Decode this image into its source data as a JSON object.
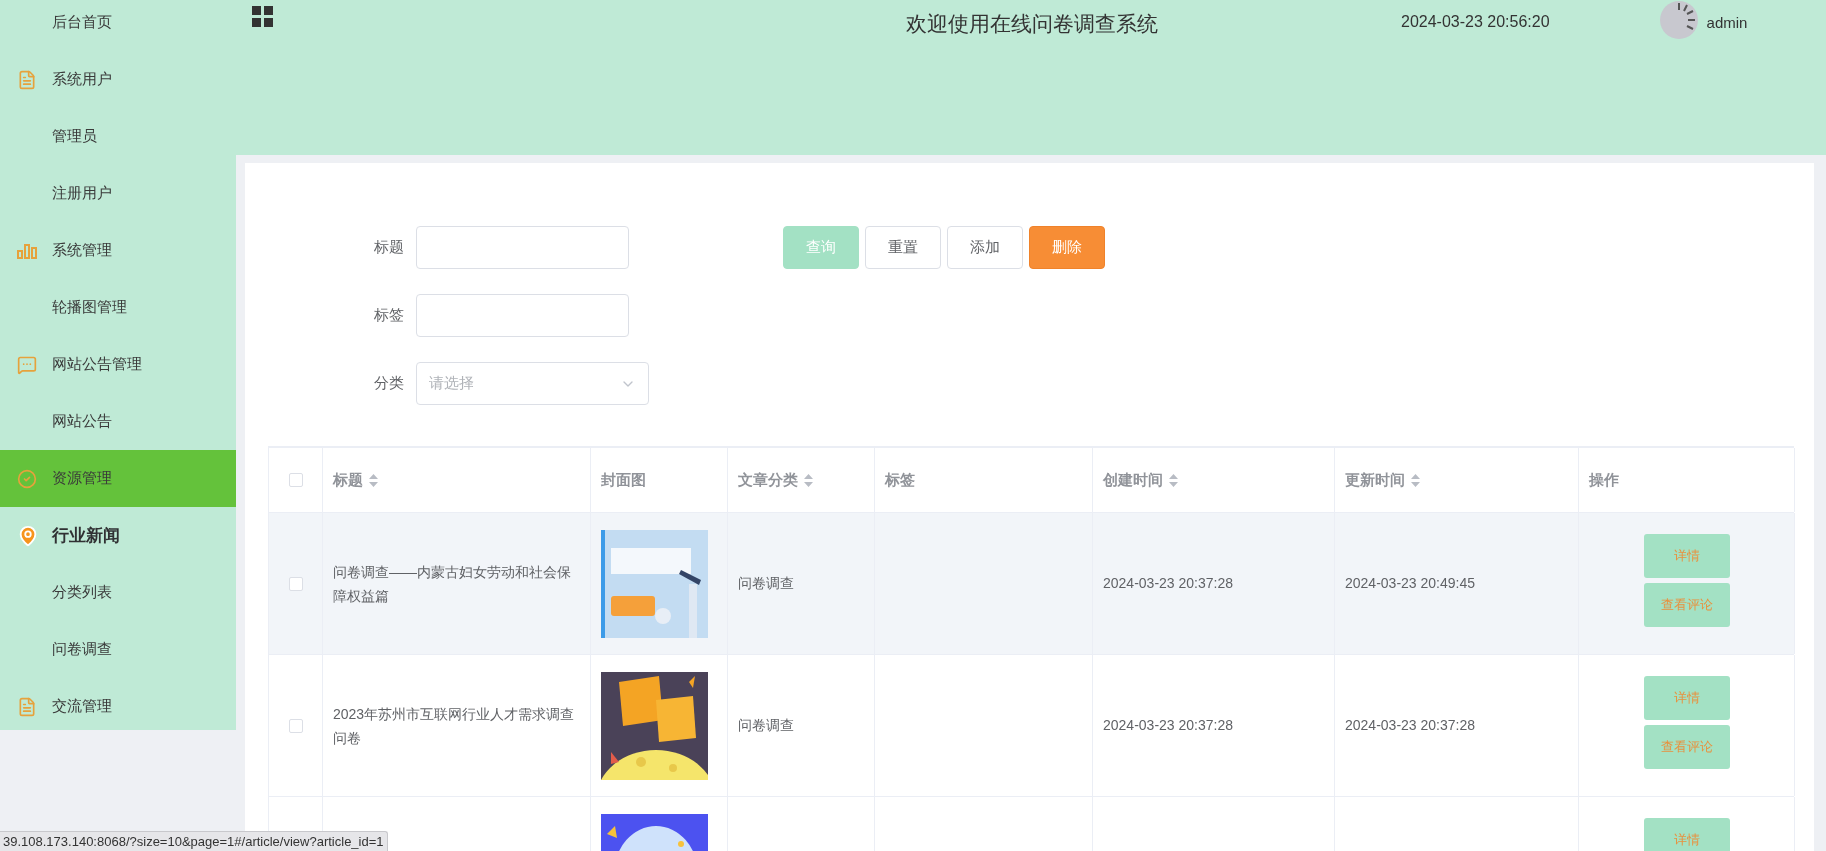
{
  "header": {
    "title": "欢迎使用在线问卷调查系统",
    "datetime": "2024-03-23 20:56:20",
    "user": "admin"
  },
  "sidebar": {
    "items": [
      {
        "label": "后台首页",
        "kind": "link",
        "selected": false,
        "active": false
      },
      {
        "label": "系统用户",
        "kind": "group",
        "selected": false,
        "active": false
      },
      {
        "label": "管理员",
        "kind": "link",
        "selected": false,
        "active": false
      },
      {
        "label": "注册用户",
        "kind": "link",
        "selected": false,
        "active": false
      },
      {
        "label": "系统管理",
        "kind": "group",
        "selected": false,
        "active": false
      },
      {
        "label": "轮播图管理",
        "kind": "link",
        "selected": false,
        "active": false
      },
      {
        "label": "网站公告管理",
        "kind": "group",
        "selected": false,
        "active": false
      },
      {
        "label": "网站公告",
        "kind": "link",
        "selected": false,
        "active": false
      },
      {
        "label": "资源管理",
        "kind": "group",
        "selected": true,
        "active": false
      },
      {
        "label": "行业新闻",
        "kind": "group",
        "selected": false,
        "active": true
      },
      {
        "label": "分类列表",
        "kind": "link",
        "selected": false,
        "active": false
      },
      {
        "label": "问卷调查",
        "kind": "link",
        "selected": false,
        "active": false
      },
      {
        "label": "交流管理",
        "kind": "group",
        "selected": false,
        "active": false
      }
    ]
  },
  "filters": [
    {
      "label": "标题",
      "kind": "text"
    },
    {
      "label": "标签",
      "kind": "text"
    },
    {
      "label": "分类",
      "kind": "select",
      "placeholder": "请选择"
    }
  ],
  "buttons": [
    {
      "label": "查询",
      "kind": "primary"
    },
    {
      "label": "重置",
      "kind": "default"
    },
    {
      "label": "添加",
      "kind": "default"
    },
    {
      "label": "删除",
      "kind": "danger"
    }
  ],
  "table": {
    "select_all": {
      "checked": false
    },
    "columns": [
      {
        "label": "标题",
        "sortable": true
      },
      {
        "label": "封面图",
        "sortable": false
      },
      {
        "label": "文章分类",
        "sortable": true
      },
      {
        "label": "标签",
        "sortable": false
      },
      {
        "label": "创建时间",
        "sortable": true
      },
      {
        "label": "更新时间",
        "sortable": true
      },
      {
        "label": "操作",
        "sortable": false
      }
    ],
    "rows": [
      {
        "checked": false,
        "highlighted": true,
        "title": "问卷调查——内蒙古妇女劳动和社会保障权益篇",
        "cover": {
          "kind": "picture"
        },
        "category": "问卷调查",
        "created": "2024-03-23 20:37:28",
        "updated": "2024-03-23 20:49:45",
        "actions": [
          "详情",
          "查看评论"
        ]
      },
      {
        "checked": false,
        "highlighted": false,
        "title": "2023年苏州市互联网行业人才需求调查问卷",
        "cover": {
          "kind": "picture"
        },
        "category": "问卷调查",
        "created": "2024-03-23 20:37:28",
        "updated": "2024-03-23 20:37:28",
        "actions": [
          "详情",
          "查看评论"
        ]
      },
      {
        "highlighted": false,
        "cover": {
          "kind": "picture"
        },
        "actions": [
          "详情"
        ]
      }
    ]
  },
  "status_bar": {
    "url": "39.108.173.140:8068/?size=10&page=1#/article/view?article_id=1"
  }
}
